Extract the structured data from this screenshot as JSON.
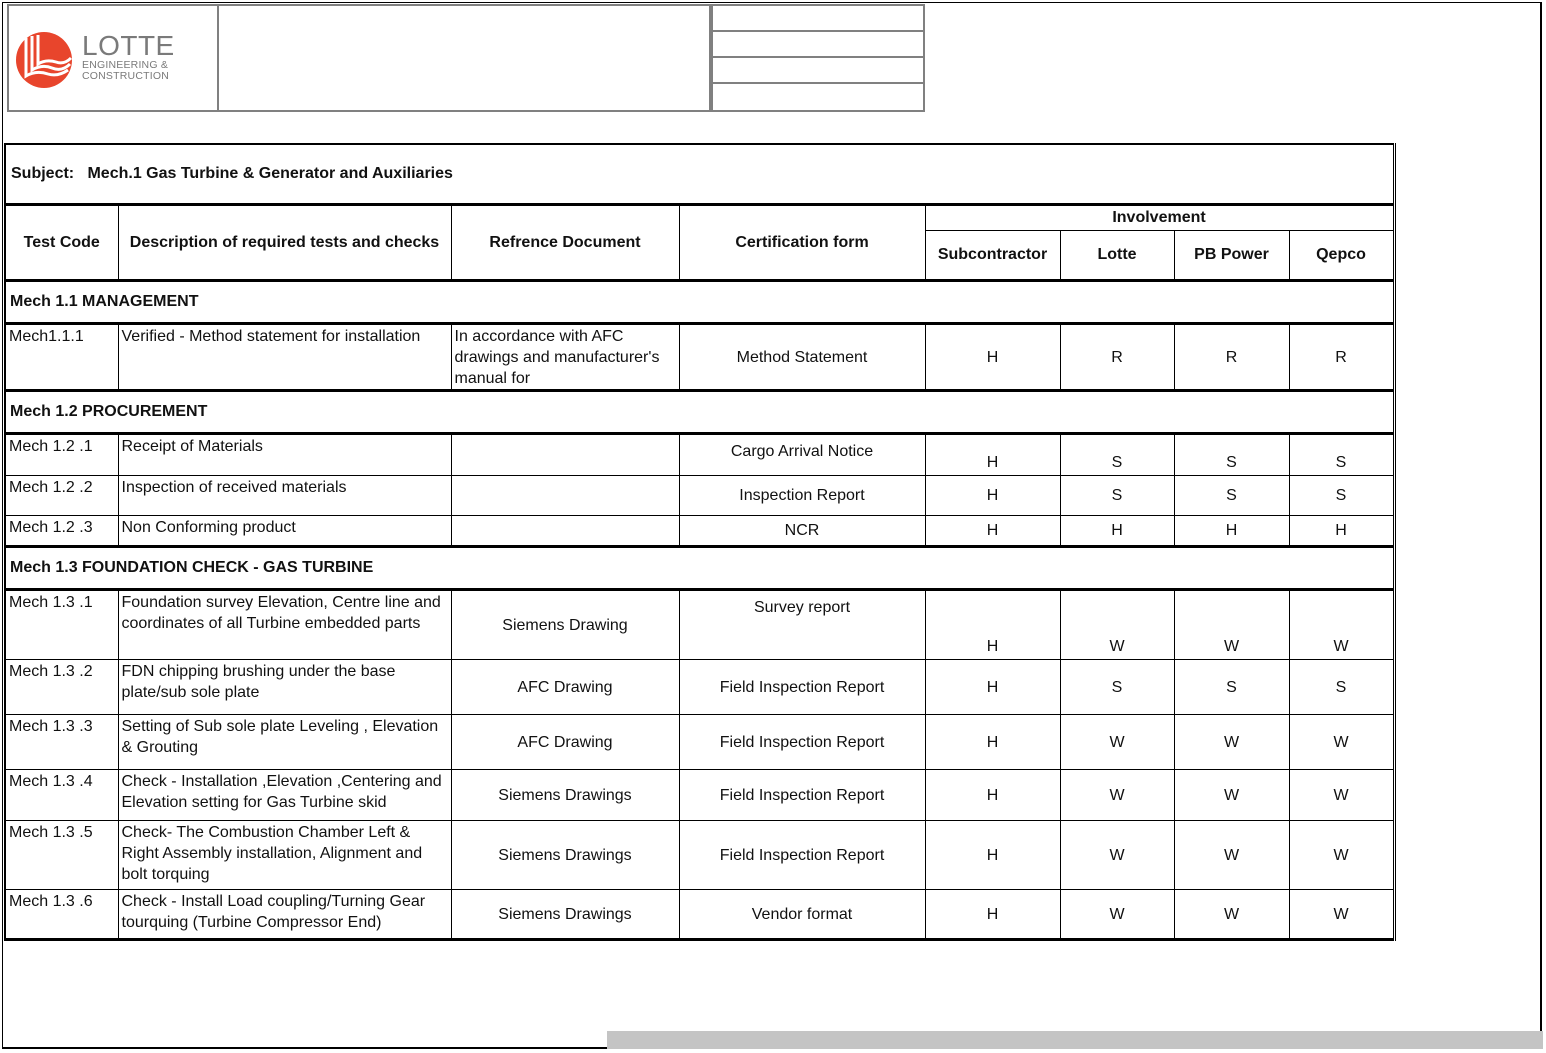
{
  "header": {
    "logo": {
      "name": "LOTTE",
      "line1": "ENGINEERING &",
      "line2": "CONSTRUCTION",
      "brand_color": "#e8452c",
      "text_color": "#7a7a7a"
    }
  },
  "subject": {
    "label": "Subject:",
    "value": "Mech.1  Gas Turbine & Generator and Auxiliaries"
  },
  "columns": {
    "test_code": "Test Code",
    "description": "Description of required tests and checks",
    "reference": "Refrence Document",
    "certification": "Certification form",
    "involvement": "Involvement",
    "parties": [
      "Subcontractor",
      "Lotte",
      "PB Power",
      "Qepco"
    ]
  },
  "sections": [
    {
      "title": "Mech 1.1   MANAGEMENT",
      "rows": [
        {
          "code": "Mech1.1.1",
          "description": "Verified - Method statement for installation",
          "reference": "In accordance with AFC drawings and manufacturer's manual for",
          "form": "Method Statement",
          "involvement": [
            "H",
            "R",
            "R",
            "R"
          ]
        }
      ]
    },
    {
      "title": "Mech 1.2  PROCUREMENT",
      "rows": [
        {
          "code": "Mech 1.2 .1",
          "description": "Receipt of Materials",
          "reference": "",
          "form": "Cargo Arrival Notice",
          "involvement": [
            "H",
            "S",
            "S",
            "S"
          ]
        },
        {
          "code": "Mech 1.2 .2",
          "description": "Inspection of received materials",
          "reference": "",
          "form": "Inspection Report",
          "involvement": [
            "H",
            "S",
            "S",
            "S"
          ]
        },
        {
          "code": "Mech 1.2 .3",
          "description": "Non Conforming product",
          "reference": "",
          "form": "NCR",
          "involvement": [
            "H",
            "H",
            "H",
            "H"
          ]
        }
      ]
    },
    {
      "title": "Mech 1.3  FOUNDATION CHECK - GAS TURBINE",
      "rows": [
        {
          "code": "Mech 1.3 .1",
          "description": "Foundation  survey Elevation, Centre line and coordinates of all Turbine embedded parts",
          "reference": "Siemens Drawing",
          "form": "Survey report",
          "involvement": [
            "H",
            "W",
            "W",
            "W"
          ]
        },
        {
          "code": "Mech 1.3 .2",
          "description": "FDN chipping brushing under the base plate/sub sole plate",
          "reference": "AFC Drawing",
          "form": "Field Inspection Report",
          "involvement": [
            "H",
            "S",
            "S",
            "S"
          ]
        },
        {
          "code": "Mech 1.3 .3",
          "description": "Setting of Sub sole plate Leveling , Elevation & Grouting",
          "reference": "AFC Drawing",
          "form": "Field Inspection Report",
          "involvement": [
            "H",
            "W",
            "W",
            "W"
          ]
        },
        {
          "code": "Mech 1.3 .4",
          "description": "Check - Installation ,Elevation ,Centering and Elevation setting for Gas Turbine skid",
          "reference": "Siemens Drawings",
          "form": "Field Inspection Report",
          "involvement": [
            "H",
            "W",
            "W",
            "W"
          ]
        },
        {
          "code": "Mech 1.3 .5",
          "description": "Check- The Combustion Chamber Left & Right Assembly installation, Alignment and bolt torquing",
          "reference": "Siemens Drawings",
          "form": "Field Inspection Report",
          "involvement": [
            "H",
            "W",
            "W",
            "W"
          ]
        },
        {
          "code": "Mech 1.3 .6",
          "description": "Check - Install Load coupling/Turning Gear tourquing (Turbine Compressor End)",
          "reference": "Siemens Drawings",
          "form": "Vendor format",
          "involvement": [
            "H",
            "W",
            "W",
            "W"
          ]
        }
      ]
    }
  ]
}
